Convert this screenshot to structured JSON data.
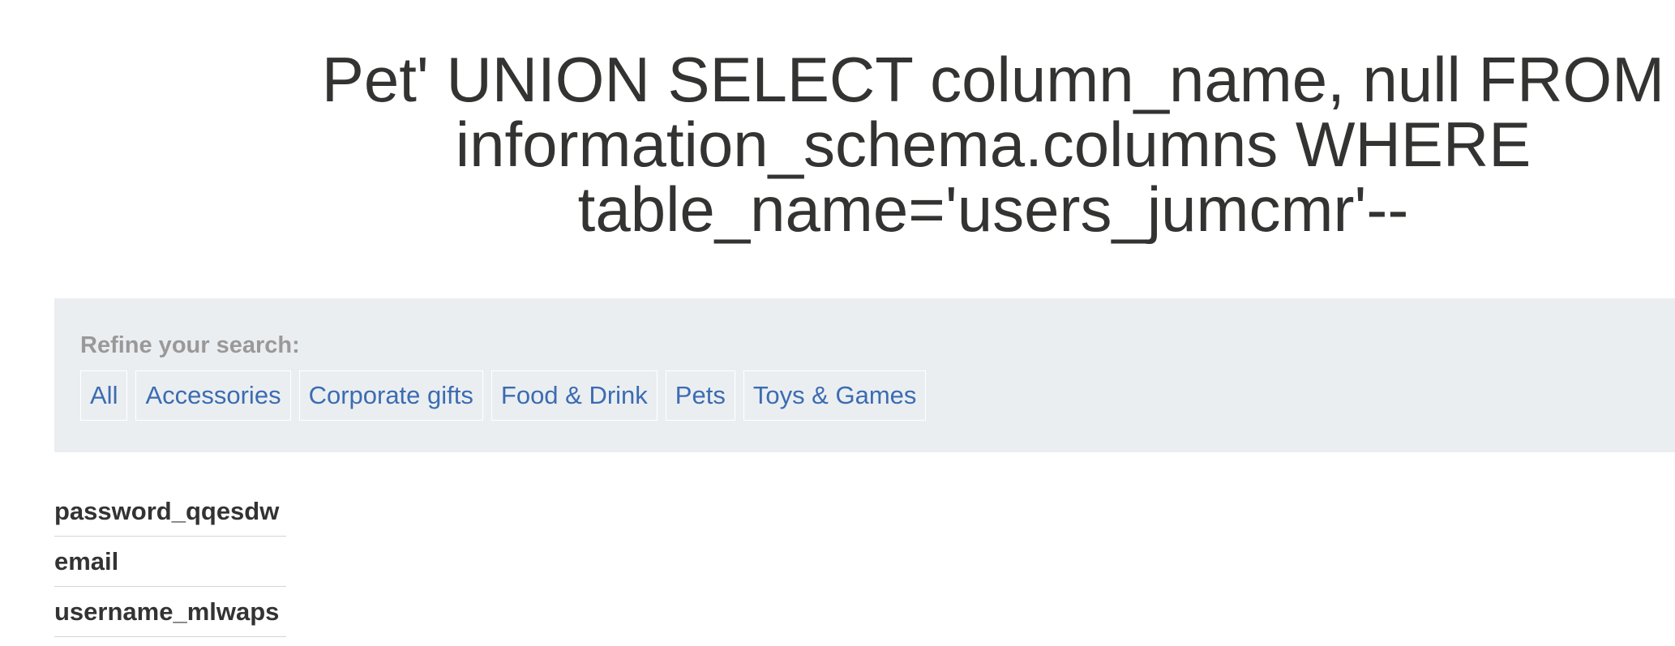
{
  "header": {
    "title": "Pet' UNION SELECT column_name, null FROM information_schema.columns WHERE table_name='users_jumcmr'--"
  },
  "filters": {
    "label": "Refine your search:",
    "links": [
      {
        "label": "All"
      },
      {
        "label": "Accessories"
      },
      {
        "label": "Corporate gifts"
      },
      {
        "label": "Food & Drink"
      },
      {
        "label": "Pets"
      },
      {
        "label": "Toys & Games"
      }
    ]
  },
  "results": {
    "rows": [
      {
        "value": "password_qqesdw"
      },
      {
        "value": "email"
      },
      {
        "value": "username_mlwaps"
      }
    ]
  },
  "colors": {
    "panel_background": "#ebeef1",
    "link": "#3b6cb2",
    "muted_label": "#999999",
    "text": "#333333"
  }
}
